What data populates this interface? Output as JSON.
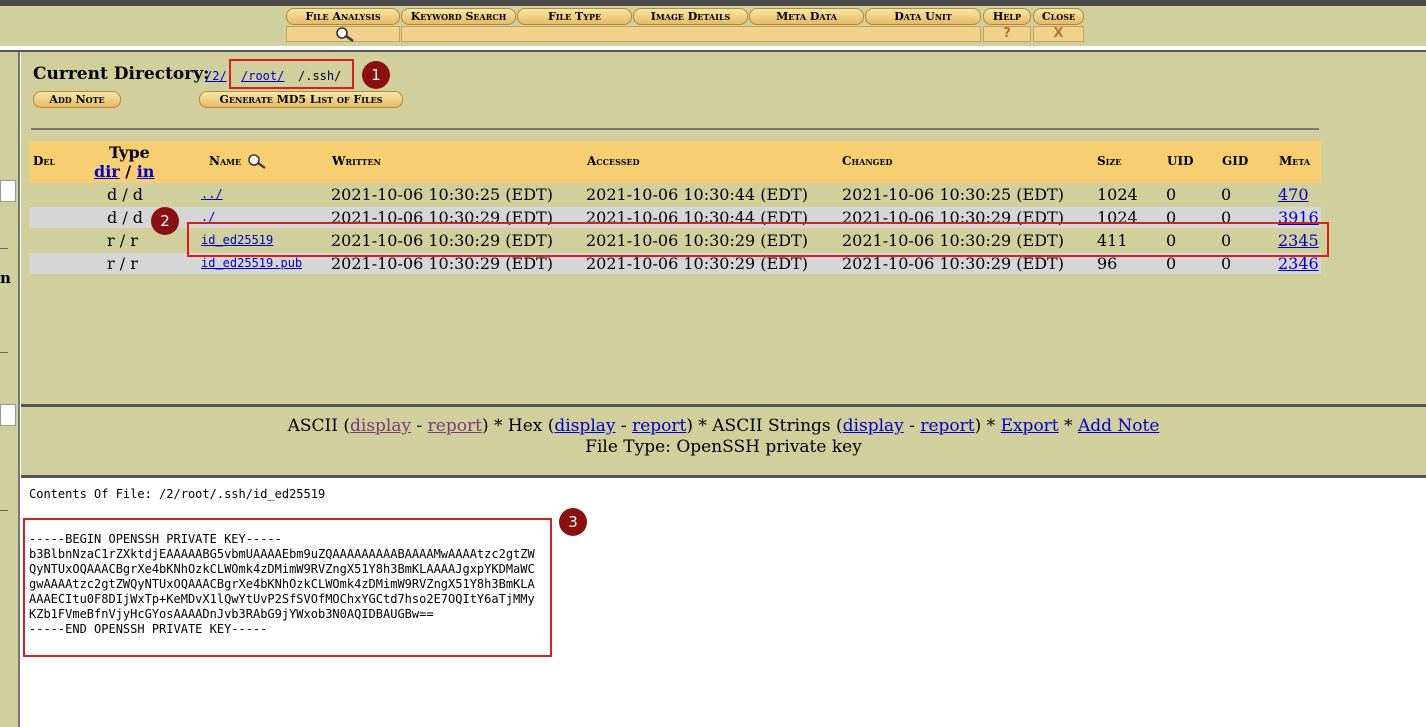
{
  "toolbar": {
    "tabs": [
      "File Analysis",
      "Keyword Search",
      "File Type",
      "Image Details",
      "Meta Data",
      "Data Unit",
      "Help",
      "Close"
    ],
    "help_sub": "?",
    "close_sub": "X"
  },
  "listing": {
    "current_directory_label": "Current Directory:",
    "path_parts": [
      "/2/",
      "/root/",
      "/.ssh/"
    ],
    "add_note_label": "Add Note",
    "md5_label": "Generate MD5 List of Files",
    "columns": {
      "del": "Del",
      "type": "Type",
      "type_dir": "dir",
      "type_sep": "/",
      "type_in": "in",
      "name": "Name",
      "written": "Written",
      "accessed": "Accessed",
      "changed": "Changed",
      "size": "Size",
      "uid": "UID",
      "gid": "GID",
      "meta": "Meta"
    },
    "rows": [
      {
        "type": "d / d",
        "name": "../",
        "written": "2021-10-06 10:30:25  (EDT)",
        "accessed": "2021-10-06 10:30:44  (EDT)",
        "changed": "2021-10-06 10:30:25  (EDT)",
        "size": "1024",
        "uid": "0",
        "gid": "0",
        "meta": "470"
      },
      {
        "type": "d / d",
        "name": "./",
        "written": "2021-10-06 10:30:29  (EDT)",
        "accessed": "2021-10-06 10:30:44  (EDT)",
        "changed": "2021-10-06 10:30:29  (EDT)",
        "size": "1024",
        "uid": "0",
        "gid": "0",
        "meta": "3916"
      },
      {
        "type": "r / r",
        "name": "id_ed25519",
        "written": "2021-10-06 10:30:29  (EDT)",
        "accessed": "2021-10-06 10:30:29  (EDT)",
        "changed": "2021-10-06 10:30:29  (EDT)",
        "size": "411",
        "uid": "0",
        "gid": "0",
        "meta": "2345"
      },
      {
        "type": "r / r",
        "name": "id_ed25519.pub",
        "written": "2021-10-06 10:30:29  (EDT)",
        "accessed": "2021-10-06 10:30:29  (EDT)",
        "changed": "2021-10-06 10:30:29  (EDT)",
        "size": "96",
        "uid": "0",
        "gid": "0",
        "meta": "2346"
      }
    ]
  },
  "viewer": {
    "ascii": "ASCII (",
    "display": "display",
    "dash": " - ",
    "report": "report",
    "close_star_hex": ") * Hex (",
    "close_star_strings": ") * ASCII Strings (",
    "close_star": ") * ",
    "export": "Export",
    "star": " * ",
    "add_note": "Add Note",
    "file_type": "File Type: OpenSSH private key"
  },
  "content": {
    "header": "Contents Of File: /2/root/.ssh/id_ed25519",
    "body": "-----BEGIN OPENSSH PRIVATE KEY-----\nb3BlbnNzaC1rZXktdjEAAAAABG5vbmUAAAAEbm9uZQAAAAAAAAABAAAAMwAAAAtzc2gtZW\nQyNTUxOQAAACBgrXe4bKNhOzkCLWOmk4zDMimW9RVZngX51Y8h3BmKLAAAAJgxpYKDMaWC\ngwAAAAtzc2gtZWQyNTUxOQAAACBgrXe4bKNhOzkCLWOmk4zDMimW9RVZngX51Y8h3BmKLA\nAAAECItu0F8DIjWxTp+KeMDvX1lQwYtUvP2SfSVOfMOChxYGCtd7hso2E7OQItY6aTjMMy\nKZb1FVmeBfnVjyHcGYosAAAADnJvb3RAbG9jYWxob3N0AQIDBAUGBw==\n-----END OPENSSH PRIVATE KEY-----"
  },
  "annotations": [
    "1",
    "2",
    "3"
  ],
  "colors": {
    "frame": "#d1cf9b",
    "header_row": "#f7cf72",
    "alt_row": "#d6d6d6",
    "link": "#0000cc",
    "highlight": "#d81e1e",
    "badge": "#8b1111"
  }
}
